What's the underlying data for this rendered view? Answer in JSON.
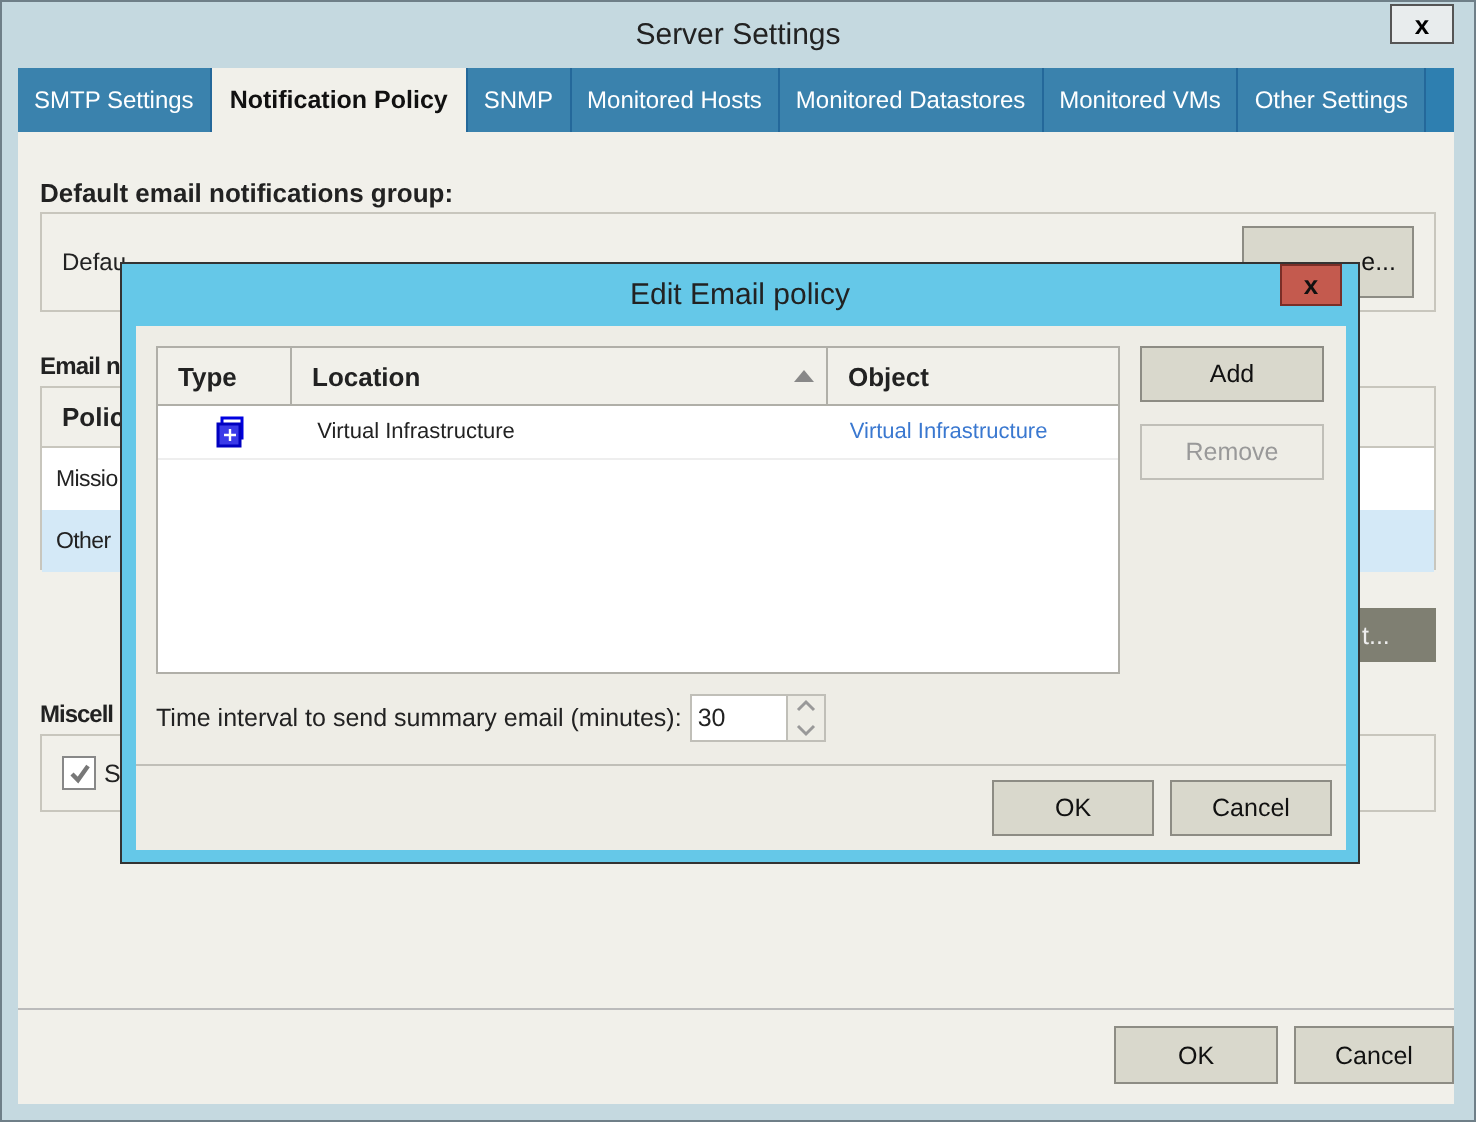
{
  "window": {
    "title": "Server Settings",
    "close": "x"
  },
  "tabs": [
    {
      "label": "SMTP Settings",
      "selected": false
    },
    {
      "label": "Notification Policy",
      "selected": true
    },
    {
      "label": "SNMP",
      "selected": false
    },
    {
      "label": "Monitored Hosts",
      "selected": false
    },
    {
      "label": "Monitored Datastores",
      "selected": false
    },
    {
      "label": "Monitored VMs",
      "selected": false
    },
    {
      "label": "Other Settings",
      "selected": false
    }
  ],
  "default_group": {
    "heading": "Default email notifications group:",
    "label": "Defau",
    "button": "e..."
  },
  "email_policies": {
    "heading": "Email n",
    "column_1": "Polic",
    "rows": [
      {
        "text": "Missio",
        "selected": false
      },
      {
        "text": "Other",
        "selected": true
      }
    ],
    "button": "t..."
  },
  "misc": {
    "heading": "Miscell",
    "checkbox": {
      "label": "S",
      "checked": true
    }
  },
  "buttons": [
    "OK",
    "Cancel"
  ],
  "dialog": {
    "title": "Edit Email policy",
    "close": "x",
    "columns": [
      "Type",
      "Location",
      "Object"
    ],
    "rows": [
      {
        "location": "Virtual Infrastructure",
        "object": "Virtual Infrastructure"
      }
    ],
    "side_buttons": [
      {
        "label": "Add",
        "disabled": false
      },
      {
        "label": "Remove",
        "disabled": true
      }
    ],
    "interval": {
      "label": "Time interval to send summary email (minutes):",
      "value": "30"
    },
    "buttons": [
      "OK",
      "Cancel"
    ]
  }
}
